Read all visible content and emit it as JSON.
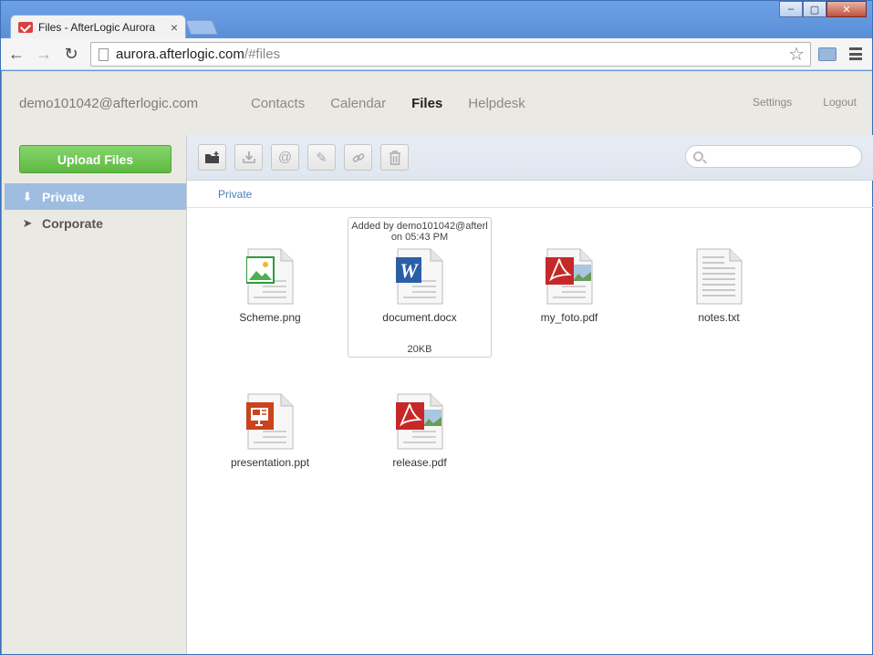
{
  "browser": {
    "tab_title": "Files - AfterLogic Aurora",
    "tab_close": "×",
    "url_host": "aurora.afterlogic.com",
    "url_path": "/#files",
    "window_controls": [
      "–",
      "▢",
      "✕"
    ]
  },
  "header": {
    "user_email": "demo101042@afterlogic.com",
    "nav": [
      "Contacts",
      "Calendar",
      "Files",
      "Helpdesk"
    ],
    "active_nav": "Files",
    "links": [
      "Settings",
      "Logout"
    ]
  },
  "sidebar": {
    "upload_label": "Upload Files",
    "storages": [
      {
        "label": "Private",
        "icon": "download-icon",
        "active": true
      },
      {
        "label": "Corporate",
        "icon": "paper-plane-icon",
        "active": false
      }
    ]
  },
  "toolbar": {
    "buttons": [
      "new-folder-icon",
      "download-icon",
      "at-sign-icon",
      "pencil-icon",
      "link-icon",
      "trash-icon"
    ],
    "search_placeholder": ""
  },
  "breadcrumb": "Private",
  "files": [
    {
      "name": "Scheme.png",
      "type": "image",
      "color": "#2f9a3a"
    },
    {
      "name": "document.docx",
      "type": "word",
      "color": "#2b5ea8",
      "added": "Added by demo101042@afterl",
      "added_time": "on 05:43 PM",
      "size": "20KB"
    },
    {
      "name": "my_foto.pdf",
      "type": "pdf",
      "color": "#c62828"
    },
    {
      "name": "notes.txt",
      "type": "text",
      "color": "#999999"
    },
    {
      "name": "presentation.ppt",
      "type": "powerpoint",
      "color": "#c9431c"
    },
    {
      "name": "release.pdf",
      "type": "pdf",
      "color": "#c62828"
    }
  ]
}
